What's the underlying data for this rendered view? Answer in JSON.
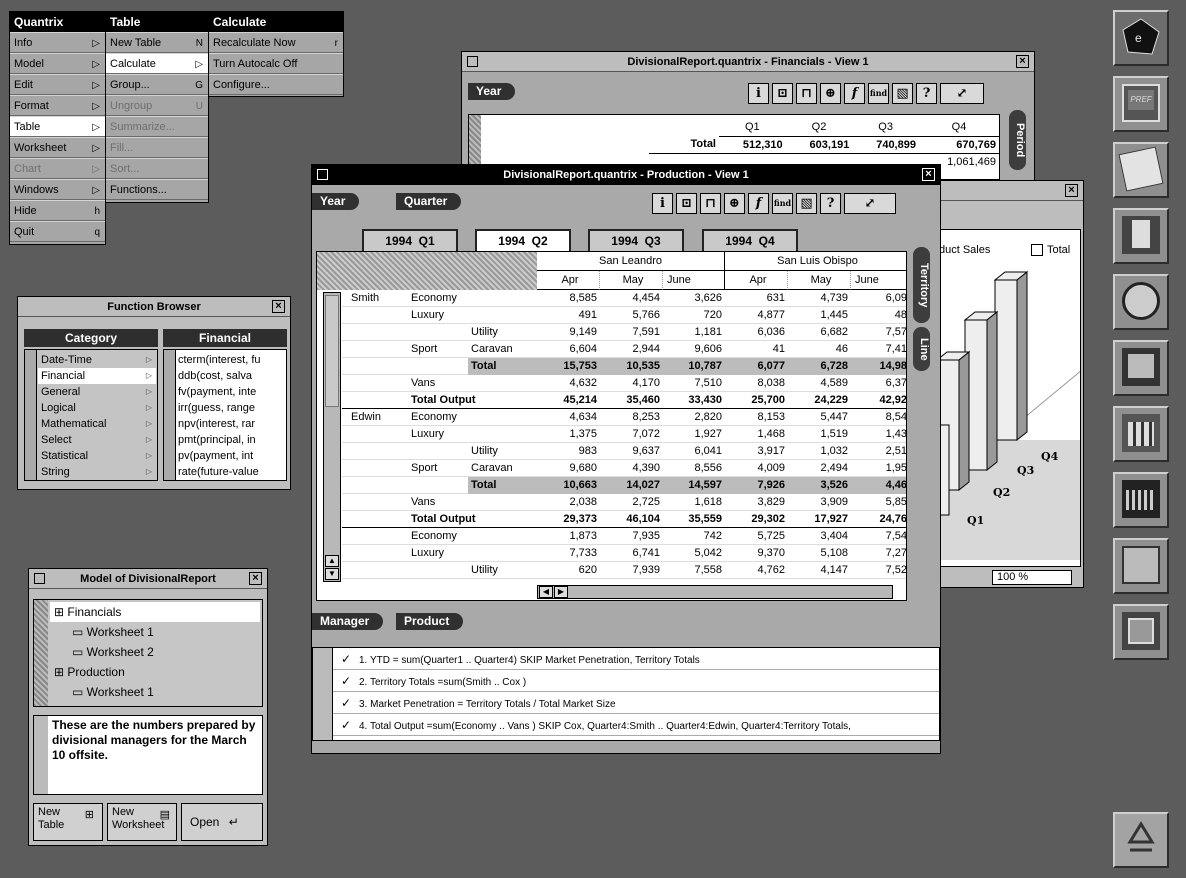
{
  "menus": {
    "quantrix": {
      "title": "Quantrix",
      "items": [
        {
          "label": "Info",
          "arrow": "▷"
        },
        {
          "label": "Model",
          "arrow": "▷"
        },
        {
          "label": "Edit",
          "arrow": "▷"
        },
        {
          "label": "Format",
          "arrow": "▷"
        },
        {
          "label": "Table",
          "arrow": "▷"
        },
        {
          "label": "Worksheet",
          "arrow": "▷"
        },
        {
          "label": "Chart",
          "arrow": "▷"
        },
        {
          "label": "Windows",
          "arrow": "▷"
        },
        {
          "label": "Hide",
          "key": "h"
        },
        {
          "label": "Quit",
          "key": "q"
        }
      ]
    },
    "table": {
      "title": "Table",
      "items": [
        {
          "label": "New Table",
          "key": "N"
        },
        {
          "label": "Calculate",
          "key": "▷"
        },
        {
          "label": "Group...",
          "key": "G"
        },
        {
          "label": "Ungroup",
          "key": "U"
        },
        {
          "label": "Summarize..."
        },
        {
          "label": "Fill..."
        },
        {
          "label": "Sort..."
        },
        {
          "label": "Functions..."
        }
      ]
    },
    "calculate": {
      "title": "Calculate",
      "items": [
        {
          "label": "Recalculate Now",
          "key": "r"
        },
        {
          "label": "Turn Autocalc Off"
        },
        {
          "label": "Configure..."
        }
      ]
    }
  },
  "financials": {
    "title": "DivisionalReport.quantrix - Financials - View 1",
    "pill": "Year",
    "cols": [
      "Q1",
      "Q2",
      "Q3",
      "Q4"
    ],
    "row_label": "Total",
    "values": [
      "512,310",
      "603,191",
      "740,899",
      "670,769"
    ],
    "partial": "1,061,469",
    "side_tab": "Period"
  },
  "toolbar": {
    "info": "i",
    "formula": "f",
    "find": "find",
    "help": "?"
  },
  "production": {
    "title": "DivisionalReport.quantrix - Production - View 1",
    "pills": [
      "Year",
      "Quarter"
    ],
    "tabs": [
      {
        "y": "1994",
        "q": "Q1"
      },
      {
        "y": "1994",
        "q": "Q2"
      },
      {
        "y": "1994",
        "q": "Q3"
      },
      {
        "y": "1994",
        "q": "Q4"
      }
    ],
    "side_tabs": [
      "Territory",
      "Line"
    ],
    "territories": [
      "San Leandro",
      "San Luis Obispo"
    ],
    "months": [
      "Apr",
      "May",
      "June",
      "Apr",
      "May",
      "June"
    ],
    "bottom_pills": [
      "Manager",
      "Product"
    ],
    "rows": [
      {
        "m": "Smith",
        "a": "Economy",
        "b": "",
        "v": [
          "8,585",
          "4,454",
          "3,626",
          "631",
          "4,739",
          "6,09"
        ]
      },
      {
        "m": "",
        "a": "Luxury",
        "b": "",
        "v": [
          "491",
          "5,766",
          "720",
          "4,877",
          "1,445",
          "48"
        ]
      },
      {
        "m": "",
        "a": "",
        "b": "Utility",
        "v": [
          "9,149",
          "7,591",
          "1,181",
          "6,036",
          "6,682",
          "7,57"
        ]
      },
      {
        "m": "",
        "a": "Sport",
        "b": "Caravan",
        "v": [
          "6,604",
          "2,944",
          "9,606",
          "41",
          "46",
          "7,41"
        ]
      },
      {
        "m": "",
        "a": "",
        "b": "Total",
        "v": [
          "15,753",
          "10,535",
          "10,787",
          "6,077",
          "6,728",
          "14,98"
        ]
      },
      {
        "m": "",
        "a": "Vans",
        "b": "",
        "v": [
          "4,632",
          "4,170",
          "7,510",
          "8,038",
          "4,589",
          "6,37"
        ]
      },
      {
        "m": "",
        "a": "Total Output",
        "b": "",
        "v": [
          "45,214",
          "35,460",
          "33,430",
          "25,700",
          "24,229",
          "42,92"
        ]
      },
      {
        "m": "Edwin",
        "a": "Economy",
        "b": "",
        "v": [
          "4,634",
          "8,253",
          "2,820",
          "8,153",
          "5,447",
          "8,54"
        ]
      },
      {
        "m": "",
        "a": "Luxury",
        "b": "",
        "v": [
          "1,375",
          "7,072",
          "1,927",
          "1,468",
          "1,519",
          "1,43"
        ]
      },
      {
        "m": "",
        "a": "",
        "b": "Utility",
        "v": [
          "983",
          "9,637",
          "6,041",
          "3,917",
          "1,032",
          "2,51"
        ]
      },
      {
        "m": "",
        "a": "Sport",
        "b": "Caravan",
        "v": [
          "9,680",
          "4,390",
          "8,556",
          "4,009",
          "2,494",
          "1,95"
        ]
      },
      {
        "m": "",
        "a": "",
        "b": "Total",
        "v": [
          "10,663",
          "14,027",
          "14,597",
          "7,926",
          "3,526",
          "4,46"
        ]
      },
      {
        "m": "",
        "a": "Vans",
        "b": "",
        "v": [
          "2,038",
          "2,725",
          "1,618",
          "3,829",
          "3,909",
          "5,85"
        ]
      },
      {
        "m": "",
        "a": "Total Output",
        "b": "",
        "v": [
          "29,373",
          "46,104",
          "35,559",
          "29,302",
          "17,927",
          "24,76"
        ]
      },
      {
        "m": "",
        "a": "Economy",
        "b": "",
        "v": [
          "1,873",
          "7,935",
          "742",
          "5,725",
          "3,404",
          "7,54"
        ]
      },
      {
        "m": "",
        "a": "Luxury",
        "b": "",
        "v": [
          "7,733",
          "6,741",
          "5,042",
          "9,370",
          "5,108",
          "7,27"
        ]
      },
      {
        "m": "",
        "a": "",
        "b": "Utility",
        "v": [
          "620",
          "7,939",
          "7,558",
          "4,762",
          "4,147",
          "7,52"
        ]
      }
    ],
    "formulas": [
      "1.  YTD = sum(Quarter1 .. Quarter4) SKIP Market Penetration, Territory Totals",
      "2.  Territory Totals =sum(Smith .. Cox )",
      "3.  Market Penetration  = Territory Totals / Total Market Size",
      "4.  Total Output  =sum(Economy .. Vans ) SKIP Cox, Quarter4:Smith .. Quarter4:Edwin, Quarter4:Territory Totals,"
    ],
    "check": "✓"
  },
  "chart": {
    "legend_text": "duct Sales",
    "legend_total": "Total",
    "axis": [
      "Q4",
      "Q3",
      "Q2",
      "Q1"
    ],
    "zoom": "100 %"
  },
  "function_browser": {
    "title": "Function Browser",
    "cat_header": "Category",
    "fin_header": "Financial",
    "categories": [
      "Date-Time",
      "Financial",
      "General",
      "Logical",
      "Mathematical",
      "Select",
      "Statistical",
      "String"
    ],
    "functions": [
      "cterm(interest, fu",
      "ddb(cost, salva",
      "fv(payment, inte",
      "irr(guess, range",
      "npv(interest, rar",
      "pmt(principal, in",
      "pv(payment, int",
      "rate(future-value"
    ]
  },
  "model": {
    "title": "Model of DivisionalReport",
    "tree": [
      {
        "label": "Financials",
        "lvl": 0
      },
      {
        "label": "Worksheet 1",
        "lvl": 1
      },
      {
        "label": "Worksheet 2",
        "lvl": 1
      },
      {
        "label": "Production",
        "lvl": 0
      },
      {
        "label": "Worksheet 1",
        "lvl": 1
      }
    ],
    "note": "These are the numbers prepared by divisional managers for the March 10 offsite.",
    "new_table": "New Table",
    "new_worksheet": "New Worksheet",
    "open": "Open"
  },
  "dock": [
    "NeXT",
    "Preferences",
    "Mail",
    "Digital Librarian",
    "TM",
    "WriteNow",
    "Improv",
    "Lotus",
    "Calendar",
    "Quantrix",
    "Recycler"
  ]
}
